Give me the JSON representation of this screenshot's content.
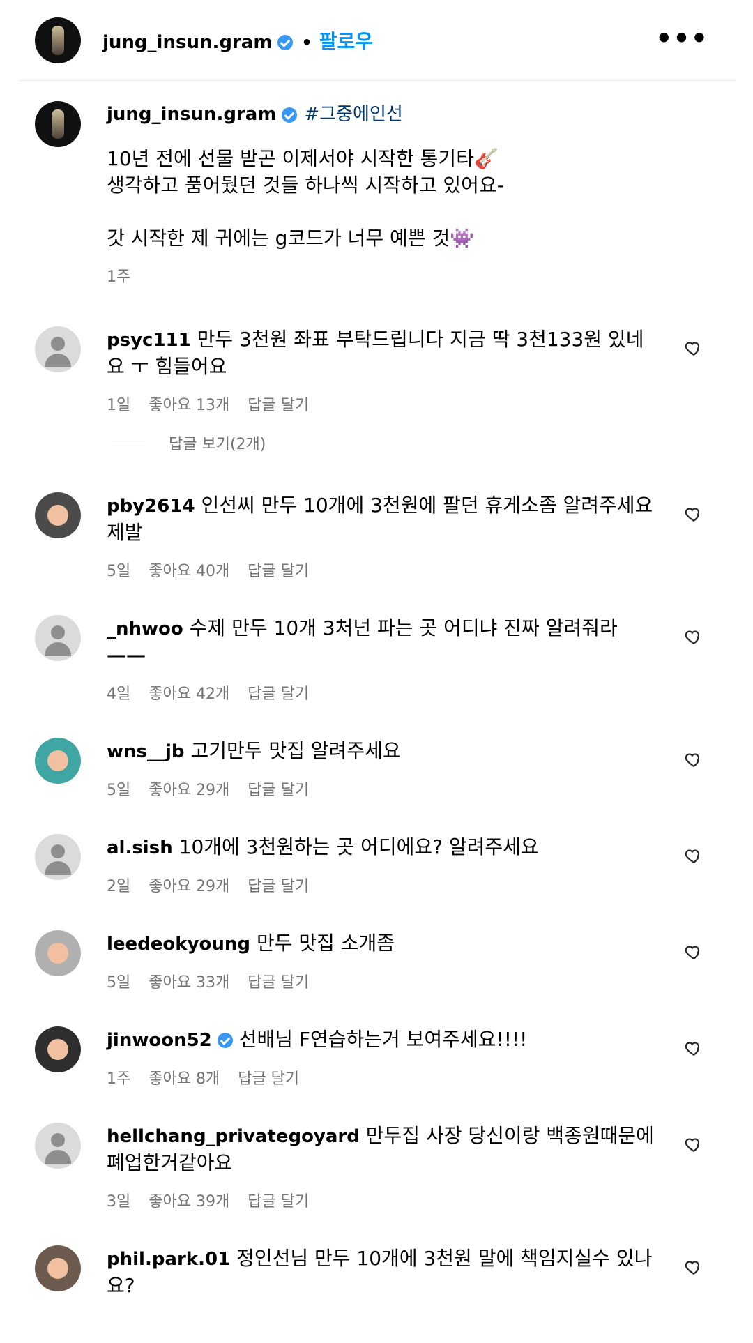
{
  "header": {
    "username": "jung_insun.gram",
    "separator": "•",
    "follow_label": "팔로우",
    "more_label": "•••"
  },
  "caption": {
    "username": "jung_insun.gram",
    "hashtag": "#그중에인선",
    "text": "10년 전에 선물 받곤 이제서야 시작한 통기타🎸\n생각하고 품어뒀던 것들 하나씩 시작하고 있어요-\n\n갓 시작한 제 귀에는 g코드가 너무 예쁜 것👾",
    "time": "1주"
  },
  "comments": [
    {
      "username": "psyc111",
      "text": "만두 3천원 좌표 부탁드립니다 지금 딱 3천133원 있네요 ㅜ 힘들어요",
      "time": "1일",
      "likes": "좋아요 13개",
      "reply": "답글 달기"
    },
    {
      "username": "pby2614",
      "text": "인선씨 만두 10개에 3천원에 팔던 휴게소좀 알려주세요 제발",
      "time": "5일",
      "likes": "좋아요 40개",
      "reply": "답글 달기"
    },
    {
      "username": "_nhwoo",
      "text": "수제 만두 10개 3처넌 파는 곳 어디냐 진짜 알려줘라 ——",
      "time": "4일",
      "likes": "좋아요 42개",
      "reply": "답글 달기"
    },
    {
      "username": "wns__jb",
      "text": "고기만두 맛집 알려주세요",
      "time": "5일",
      "likes": "좋아요 29개",
      "reply": "답글 달기"
    },
    {
      "username": "al.sish",
      "text": "10개에 3천원하는 곳 어디에요? 알려주세요",
      "time": "2일",
      "likes": "좋아요 29개",
      "reply": "답글 달기"
    },
    {
      "username": "leedeokyoung",
      "text": "만두 맛집 소개좀",
      "time": "5일",
      "likes": "좋아요 33개",
      "reply": "답글 달기"
    },
    {
      "username": "jinwoon52",
      "text": "선배님 F연습하는거 보여주세요!!!!",
      "time": "1주",
      "likes": "좋아요 8개",
      "reply": "답글 달기",
      "verified": true
    },
    {
      "username": "hellchang_privategoyard",
      "text": "만두집 사장 당신이랑 백종원때문에 폐업한거같아요",
      "time": "3일",
      "likes": "좋아요 39개",
      "reply": "답글 달기"
    },
    {
      "username": "phil.park.01",
      "text": "정인선님 만두 10개에 3천원 말에 책임지실수 있나요?",
      "time": "",
      "likes": "",
      "reply": ""
    }
  ],
  "view_replies": "답글 보기(2개)"
}
